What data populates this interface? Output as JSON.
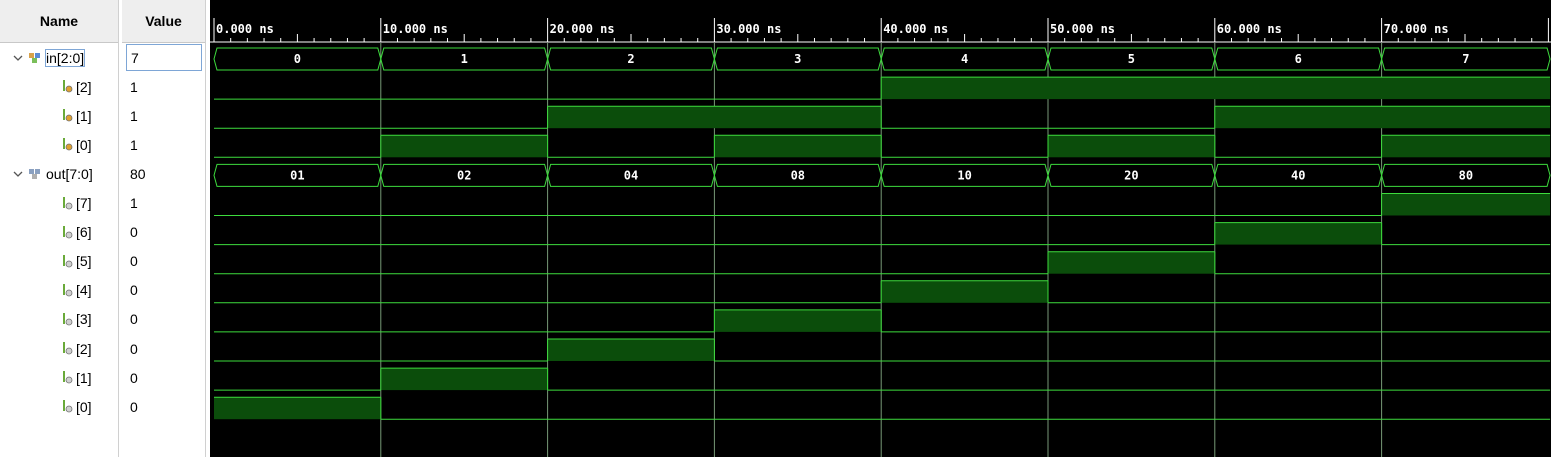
{
  "headers": {
    "name": "Name",
    "value": "Value"
  },
  "colors": {
    "wave": "#3ddc3d",
    "fill": "#0b4d0b",
    "bg": "#000000",
    "grid": "#8cb48c"
  },
  "time_axis": {
    "unit": "ns",
    "ticks": [
      "0.000 ns",
      "10.000 ns",
      "20.000 ns",
      "30.000 ns",
      "40.000 ns",
      "50.000 ns",
      "60.000 ns",
      "70.000 ns"
    ],
    "tick_values": [
      0,
      10,
      20,
      30,
      40,
      50,
      60,
      70
    ],
    "visible_end": 80.1
  },
  "signals": [
    {
      "name": "in[2:0]",
      "value": "7",
      "type": "bus",
      "expanded": true,
      "icon": "bus-input-icon",
      "selected": true,
      "segments": [
        {
          "t0": 0,
          "t1": 10,
          "v": "0"
        },
        {
          "t0": 10,
          "t1": 20,
          "v": "1"
        },
        {
          "t0": 20,
          "t1": 30,
          "v": "2"
        },
        {
          "t0": 30,
          "t1": 40,
          "v": "3"
        },
        {
          "t0": 40,
          "t1": 50,
          "v": "4"
        },
        {
          "t0": 50,
          "t1": 60,
          "v": "5"
        },
        {
          "t0": 60,
          "t1": 70,
          "v": "6"
        },
        {
          "t0": 70,
          "t1": 80.1,
          "v": "7"
        }
      ]
    },
    {
      "name": "[2]",
      "value": "1",
      "type": "bit",
      "child": true,
      "icon": "bit-input-icon",
      "transitions": [
        {
          "t": 0,
          "v": 0
        },
        {
          "t": 40,
          "v": 1
        }
      ]
    },
    {
      "name": "[1]",
      "value": "1",
      "type": "bit",
      "child": true,
      "icon": "bit-input-icon",
      "transitions": [
        {
          "t": 0,
          "v": 0
        },
        {
          "t": 20,
          "v": 1
        },
        {
          "t": 40,
          "v": 0
        },
        {
          "t": 60,
          "v": 1
        }
      ]
    },
    {
      "name": "[0]",
      "value": "1",
      "type": "bit",
      "child": true,
      "icon": "bit-input-icon",
      "transitions": [
        {
          "t": 0,
          "v": 0
        },
        {
          "t": 10,
          "v": 1
        },
        {
          "t": 20,
          "v": 0
        },
        {
          "t": 30,
          "v": 1
        },
        {
          "t": 40,
          "v": 0
        },
        {
          "t": 50,
          "v": 1
        },
        {
          "t": 60,
          "v": 0
        },
        {
          "t": 70,
          "v": 1
        }
      ]
    },
    {
      "name": "out[7:0]",
      "value": "80",
      "type": "bus",
      "expanded": true,
      "icon": "bus-output-icon",
      "segments": [
        {
          "t0": 0,
          "t1": 10,
          "v": "01"
        },
        {
          "t0": 10,
          "t1": 20,
          "v": "02"
        },
        {
          "t0": 20,
          "t1": 30,
          "v": "04"
        },
        {
          "t0": 30,
          "t1": 40,
          "v": "08"
        },
        {
          "t0": 40,
          "t1": 50,
          "v": "10"
        },
        {
          "t0": 50,
          "t1": 60,
          "v": "20"
        },
        {
          "t0": 60,
          "t1": 70,
          "v": "40"
        },
        {
          "t0": 70,
          "t1": 80.1,
          "v": "80"
        }
      ]
    },
    {
      "name": "[7]",
      "value": "1",
      "type": "bit",
      "child": true,
      "icon": "bit-output-icon",
      "transitions": [
        {
          "t": 0,
          "v": 0
        },
        {
          "t": 70,
          "v": 1
        }
      ]
    },
    {
      "name": "[6]",
      "value": "0",
      "type": "bit",
      "child": true,
      "icon": "bit-output-icon",
      "transitions": [
        {
          "t": 0,
          "v": 0
        },
        {
          "t": 60,
          "v": 1
        },
        {
          "t": 70,
          "v": 0
        }
      ]
    },
    {
      "name": "[5]",
      "value": "0",
      "type": "bit",
      "child": true,
      "icon": "bit-output-icon",
      "transitions": [
        {
          "t": 0,
          "v": 0
        },
        {
          "t": 50,
          "v": 1
        },
        {
          "t": 60,
          "v": 0
        }
      ]
    },
    {
      "name": "[4]",
      "value": "0",
      "type": "bit",
      "child": true,
      "icon": "bit-output-icon",
      "transitions": [
        {
          "t": 0,
          "v": 0
        },
        {
          "t": 40,
          "v": 1
        },
        {
          "t": 50,
          "v": 0
        }
      ]
    },
    {
      "name": "[3]",
      "value": "0",
      "type": "bit",
      "child": true,
      "icon": "bit-output-icon",
      "transitions": [
        {
          "t": 0,
          "v": 0
        },
        {
          "t": 30,
          "v": 1
        },
        {
          "t": 40,
          "v": 0
        }
      ]
    },
    {
      "name": "[2]",
      "value": "0",
      "type": "bit",
      "child": true,
      "icon": "bit-output-icon",
      "transitions": [
        {
          "t": 0,
          "v": 0
        },
        {
          "t": 20,
          "v": 1
        },
        {
          "t": 30,
          "v": 0
        }
      ]
    },
    {
      "name": "[1]",
      "value": "0",
      "type": "bit",
      "child": true,
      "icon": "bit-output-icon",
      "transitions": [
        {
          "t": 0,
          "v": 0
        },
        {
          "t": 10,
          "v": 1
        },
        {
          "t": 20,
          "v": 0
        }
      ]
    },
    {
      "name": "[0]",
      "value": "0",
      "type": "bit",
      "child": true,
      "icon": "bit-output-icon",
      "transitions": [
        {
          "t": 0,
          "v": 1
        },
        {
          "t": 10,
          "v": 0
        }
      ]
    }
  ]
}
